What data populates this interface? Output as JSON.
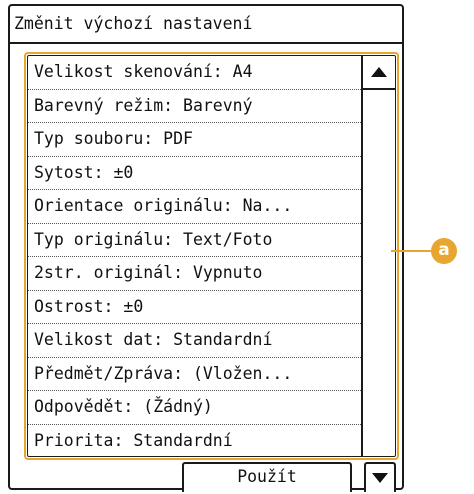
{
  "screen": {
    "title": "Změnit výchozí nastavení"
  },
  "settings": {
    "items": [
      "Velikost skenování: A4",
      "Barevný režim: Barevný",
      "Typ souboru: PDF",
      "Sytost: ±0",
      "Orientace originálu: Na...",
      "Typ originálu: Text/Foto",
      "2str. originál: Vypnuto",
      "Ostrost: ±0",
      "Velikost dat: Standardní",
      "Předmět/Zpráva: (Vložen...",
      "Odpovědět: (Žádný)",
      "Priorita: Standardní"
    ]
  },
  "footer": {
    "apply_label": "Použít"
  },
  "icons": {
    "scroll_up": "triangle-up-icon",
    "scroll_down": "triangle-down-icon"
  },
  "callout": {
    "label": "a",
    "color": "#e8a530"
  }
}
